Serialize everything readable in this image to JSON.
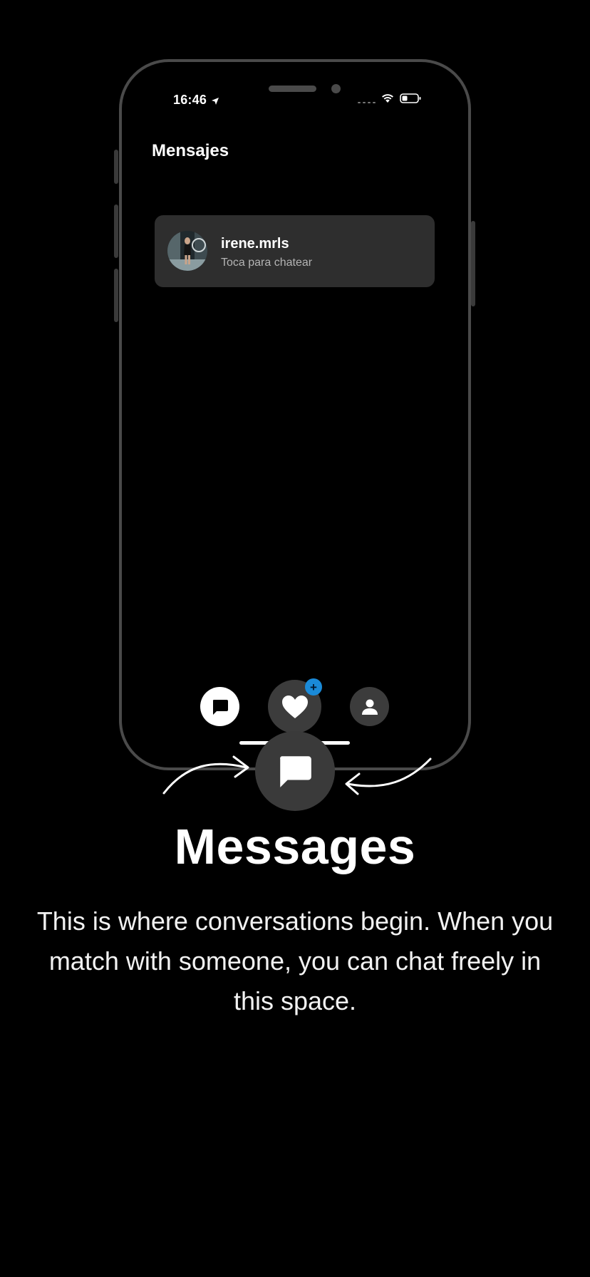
{
  "status_bar": {
    "time": "16:46"
  },
  "app": {
    "title": "Mensajes"
  },
  "chat_list": [
    {
      "name": "irene.mrls",
      "subtitle": "Toca para chatear"
    }
  ],
  "bottom_nav": {
    "items": [
      {
        "icon": "chat-bubble-icon",
        "active": true
      },
      {
        "icon": "heart-icon",
        "badge": "+"
      },
      {
        "icon": "person-icon"
      }
    ]
  },
  "onboarding": {
    "title": "Messages",
    "description": "This is where conversations begin. When you match with someone, you can chat freely in this space."
  },
  "colors": {
    "background": "#000000",
    "card": "#2e2e2e",
    "badge": "#1a8ad8",
    "frame": "#4a4a4a"
  }
}
